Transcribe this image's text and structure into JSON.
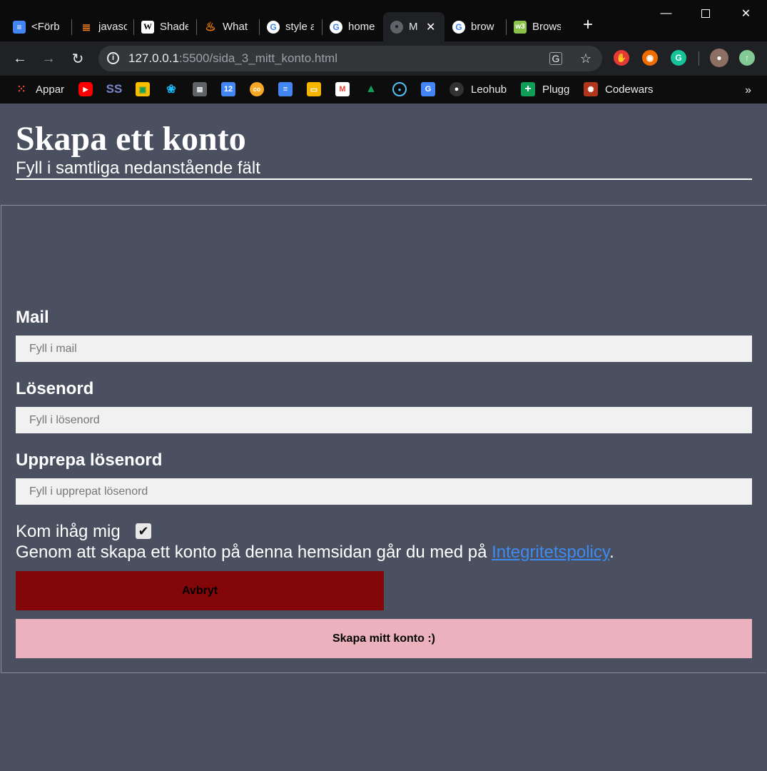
{
  "browser": {
    "tabs": [
      {
        "label": "<Förb",
        "icon": "docs-icon",
        "color": "#4285f4"
      },
      {
        "label": "javasc",
        "icon": "stackoverflow-icon",
        "color": "#f48024"
      },
      {
        "label": "Shade",
        "icon": "wikipedia-icon",
        "color": "#ffffff"
      },
      {
        "label": "What",
        "icon": "flame-icon",
        "color": "#f57c00"
      },
      {
        "label": "style a",
        "icon": "google-icon",
        "color": "#ffffff"
      },
      {
        "label": "home",
        "icon": "google-icon",
        "color": "#ffffff"
      },
      {
        "label": "M",
        "icon": "globe-icon",
        "color": "#9aa0a6"
      },
      {
        "label": "brow",
        "icon": "google-icon",
        "color": "#ffffff"
      },
      {
        "label": "Brows",
        "icon": "w3schools-icon",
        "color": "#8bc34a"
      }
    ],
    "url_host": "127.0.0.1",
    "url_rest": ":5500/sida_3_mitt_konto.html",
    "bookmarks": [
      {
        "label": "Appar",
        "icon": "apps-grid-icon",
        "color": "#ea4335"
      },
      {
        "label": "",
        "icon": "youtube-icon",
        "color": "#ff0000"
      },
      {
        "label": "",
        "icon": "ss-icon",
        "color": "#3f51b5"
      },
      {
        "label": "",
        "icon": "classroom-icon",
        "color": "#fbbc04"
      },
      {
        "label": "",
        "icon": "figma-icon",
        "color": "#1abcfe"
      },
      {
        "label": "",
        "icon": "news-icon",
        "color": "#9aa0a6"
      },
      {
        "label": "",
        "icon": "calendar-icon",
        "color": "#4285f4"
      },
      {
        "label": "",
        "icon": "cc-icon",
        "color": "#f9a825"
      },
      {
        "label": "",
        "icon": "docs-icon",
        "color": "#4285f4"
      },
      {
        "label": "",
        "icon": "slides-icon",
        "color": "#f4b400"
      },
      {
        "label": "",
        "icon": "gmail-icon",
        "color": "#ea4335"
      },
      {
        "label": "",
        "icon": "drive-icon",
        "color": "#0f9d58"
      },
      {
        "label": "",
        "icon": "circle-icon",
        "color": "#4fc3f7"
      },
      {
        "label": "",
        "icon": "translate-icon",
        "color": "#4285f4"
      },
      {
        "label": "Leohub",
        "icon": "github-icon",
        "color": "#333333"
      },
      {
        "label": "Plugg",
        "icon": "plus-icon",
        "color": "#0f9d58"
      },
      {
        "label": "Codewars",
        "icon": "codewars-icon",
        "color": "#b1361e"
      }
    ]
  },
  "form": {
    "title": "Skapa ett konto",
    "subtitle": "Fyll i samtliga nedanstående fält",
    "mail_label": "Mail",
    "mail_placeholder": "Fyll i mail",
    "password_label": "Lösenord",
    "password_placeholder": "Fyll i lösenord",
    "repeat_label": "Upprepa lösenord",
    "repeat_placeholder": "Fyll i upprepat lösenord",
    "remember_label": "Kom ihåg mig",
    "remember_checked": true,
    "terms_prefix": "Genom att skapa ett konto på denna hemsidan går du med på ",
    "terms_link": "Integritetspolicy",
    "terms_suffix": ".",
    "cancel_label": "Avbryt",
    "create_label": "Skapa mitt konto :)",
    "cancel_color": "#830609",
    "create_color": "#ebb1bd",
    "page_bg": "#4a5060"
  }
}
